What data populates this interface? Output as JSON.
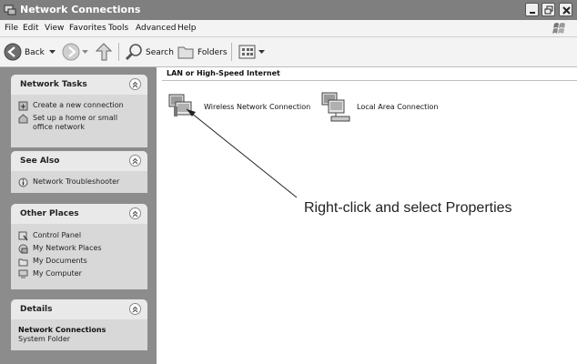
{
  "window": {
    "title": "Network Connections"
  },
  "menubar": {
    "items": [
      "File",
      "Edit",
      "View",
      "Favorites",
      "Tools",
      "Advanced",
      "Help"
    ]
  },
  "toolbar": {
    "back_label": "Back",
    "search_label": "Search",
    "folders_label": "Folders"
  },
  "sidebar": {
    "network_tasks": {
      "title": "Network Tasks",
      "items": [
        "Create a new connection",
        "Set up a home or small office network"
      ]
    },
    "see_also": {
      "title": "See Also",
      "items": [
        "Network Troubleshooter"
      ]
    },
    "other_places": {
      "title": "Other Places",
      "items": [
        "Control Panel",
        "My Network Places",
        "My Documents",
        "My Computer"
      ]
    },
    "details": {
      "title": "Details",
      "name": "Network Connections",
      "type": "System Folder"
    }
  },
  "main": {
    "group_header": "LAN or High-Speed Internet",
    "connections": [
      "Wireless Network Connection",
      "Local Area Connection"
    ]
  },
  "annotation": "Right-click and select Properties",
  "colors": {
    "titlebar": "#7f7f7f",
    "sidepane": "#8c8c8c",
    "panel_body": "#d8d8d8",
    "panel_head": "#e9e9e9"
  }
}
